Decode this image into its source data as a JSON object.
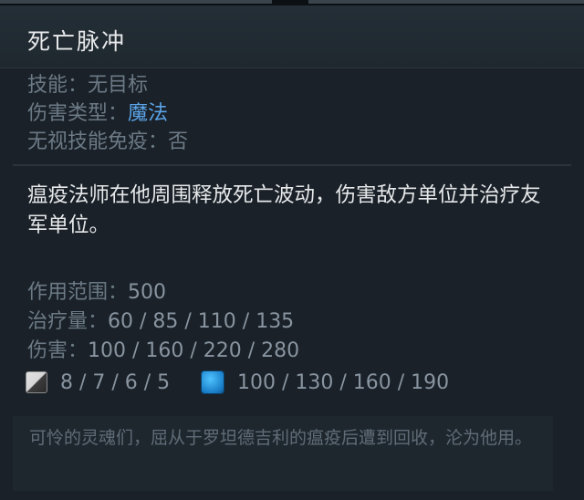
{
  "ability": {
    "name": "死亡脉冲",
    "attributes": [
      {
        "label": "技能：",
        "value": "无目标",
        "value_color": "#6c7a86"
      },
      {
        "label": "伤害类型：",
        "value": "魔法",
        "value_color": "#5aa3e6"
      },
      {
        "label": "无视技能免疫：",
        "value": "否",
        "value_color": "#6c7a86"
      }
    ],
    "description": "瘟疫法师在他周围释放死亡波动，伤害敌方单位并治疗友军单位。",
    "stats": [
      {
        "label": "作用范围：",
        "value": "500"
      },
      {
        "label": "治疗量：",
        "value": "60 / 85 / 110 / 135"
      },
      {
        "label": "伤害：",
        "value": "100 / 160 / 220 / 280"
      }
    ],
    "cooldown": {
      "icon": "cooldown-icon",
      "value": "8 / 7 / 6 / 5"
    },
    "mana_cost": {
      "icon": "mana-icon",
      "value": "100 / 130 / 160 / 190",
      "color": "#1a8fe0"
    },
    "lore": "可怜的灵魂们，屈从于罗坦德吉利的瘟疫后遭到回收，沦为他用。"
  }
}
